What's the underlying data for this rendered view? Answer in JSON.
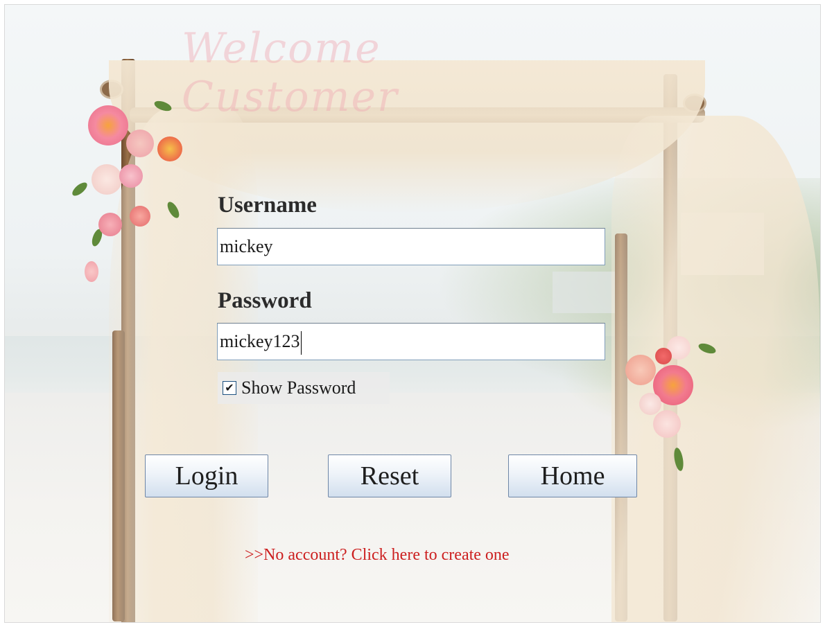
{
  "window": {
    "title": "Welcome Customer"
  },
  "form": {
    "username_label": "Username",
    "username_value": "mickey",
    "password_label": "Password",
    "password_value": "mickey123",
    "show_password_label": "Show Password",
    "show_password_checked": true,
    "check_glyph": "✔"
  },
  "buttons": {
    "login": "Login",
    "reset": "Reset",
    "home": "Home"
  },
  "links": {
    "create_account": ">>No account? Click here to create one"
  },
  "colors": {
    "title": "#f0aab4",
    "link": "#cc1f1f",
    "button_border": "#6e86a6"
  }
}
